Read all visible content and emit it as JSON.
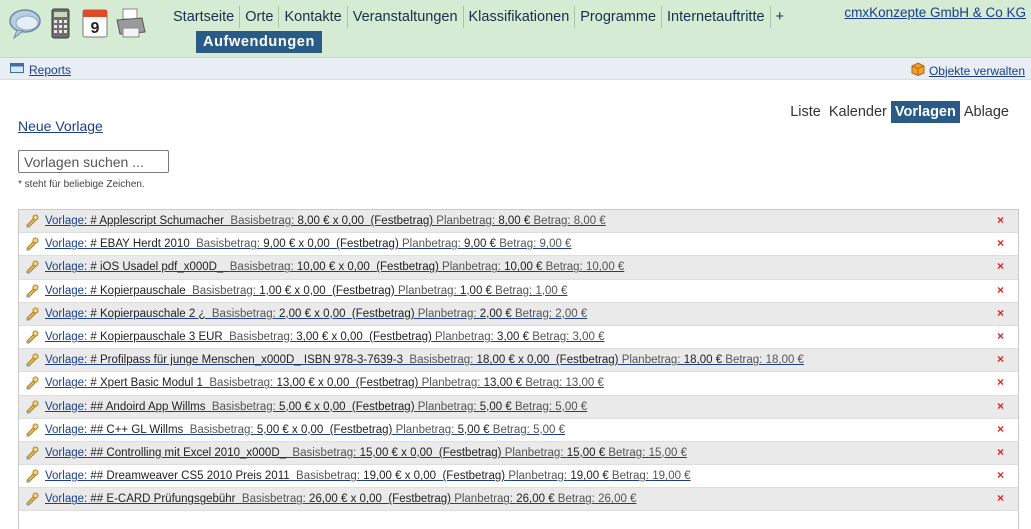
{
  "header": {
    "app_icons": [
      "chat-icon",
      "calculator-icon",
      "calendar-icon",
      "printer-icon"
    ],
    "calendar_day": "9",
    "nav": [
      "Startseite",
      "Orte",
      "Kontakte",
      "Veranstaltungen",
      "Klassifikationen",
      "Programme",
      "Internetauftritte",
      "+"
    ],
    "active_section": "Aufwendungen",
    "company": "cmxKonzepte GmbH & Co KG"
  },
  "subbar": {
    "reports": "Reports",
    "objekte": "Objekte verwalten"
  },
  "view_tabs": [
    "Liste",
    "Kalender",
    "Vorlagen",
    "Ablage"
  ],
  "active_view": "Vorlagen",
  "neue_vorlage": "Neue Vorlage",
  "search": {
    "placeholder": "Vorlagen suchen ...",
    "hint": "* steht für beliebige Zeichen."
  },
  "labels": {
    "prefix": "Vorlage:",
    "basis": "Basisbetrag:",
    "fest": "(Festbetrag)",
    "plan": "Planbetrag:",
    "betrag": "Betrag:",
    "delete": "×"
  },
  "templates": [
    {
      "name": "# Applescript Schumacher",
      "basis": "8,00 € x 0,00",
      "plan": "8,00 €",
      "betrag": "8,00 €"
    },
    {
      "name": "# EBAY Herdt 2010",
      "basis": "9,00 € x 0,00",
      "plan": "9,00 €",
      "betrag": "9,00 €"
    },
    {
      "name": "# iOS Usadel pdf_x000D_",
      "basis": "10,00 € x 0,00",
      "plan": "10,00 €",
      "betrag": "10,00 €"
    },
    {
      "name": "# Kopierpauschale",
      "basis": "1,00 € x 0,00",
      "plan": "1,00 €",
      "betrag": "1,00 €"
    },
    {
      "name": "# Kopierpauschale 2 ¿",
      "basis": "2,00 € x 0,00",
      "plan": "2,00 €",
      "betrag": "2,00 €"
    },
    {
      "name": "# Kopierpauschale 3 EUR",
      "basis": "3,00 € x 0,00",
      "plan": "3,00 €",
      "betrag": "3,00 €"
    },
    {
      "name": "# Profilpass für junge Menschen_x000D_ ISBN 978-3-7639-3",
      "basis": "18,00 € x 0,00",
      "plan": "18,00 €",
      "betrag": "18,00 €"
    },
    {
      "name": "# Xpert Basic Modul 1",
      "basis": "13,00 € x 0,00",
      "plan": "13,00 €",
      "betrag": "13,00 €"
    },
    {
      "name": "## Andoird App Willms",
      "basis": "5,00 € x 0,00",
      "plan": "5,00 €",
      "betrag": "5,00 €"
    },
    {
      "name": "## C++ GL Willms",
      "basis": "5,00 € x 0,00",
      "plan": "5,00 €",
      "betrag": "5,00 €"
    },
    {
      "name": "## Controlling mit Excel 2010_x000D_",
      "basis": "15,00 € x 0,00",
      "plan": "15,00 €",
      "betrag": "15,00 €"
    },
    {
      "name": "## Dreamweaver CS5 2010 Preis 2011",
      "basis": "19,00 € x 0,00",
      "plan": "19,00 €",
      "betrag": "19,00 €"
    },
    {
      "name": "## E-CARD Prüfungsgebühr",
      "basis": "26,00 € x 0,00",
      "plan": "26,00 €",
      "betrag": "26,00 €"
    }
  ]
}
